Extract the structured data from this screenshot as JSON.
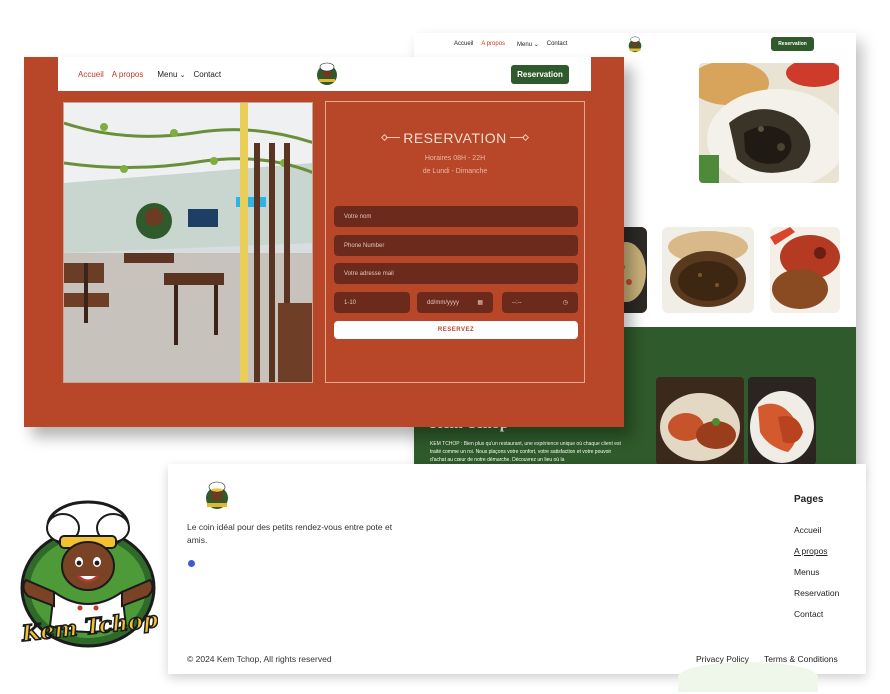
{
  "back": {
    "nav": [
      "Accueil",
      "A propos",
      "Menu",
      "Contact"
    ],
    "reservation": "Reservation",
    "brand": "Kem Tchop",
    "desc": "KEM TCHOP : Bien plus qu'un restaurant, une expérience unique où chaque client est traité comme un roi. Nous plaçons votre confort, votre satisfaction et votre pouvoir d'achat au cœur de notre démarche. Découvrez un lieu où la"
  },
  "nav": {
    "accueil": "Accueil",
    "apropos": "A propos",
    "menu": "Menu",
    "contact": "Contact",
    "reservation": "Reservation",
    "chevron": "chevron-down-icon"
  },
  "form": {
    "title": "RESERVATION",
    "hours": "Horaires 08H - 22H",
    "days": "de Lundi  - Dimanche",
    "name_placeholder": "Votre nom",
    "phone_placeholder": "Phone Number",
    "email_placeholder": "Votre adresse mail",
    "guests": "1-10",
    "date": "dd/mm/yyyy",
    "time": "--:--",
    "submit": "RESERVEZ"
  },
  "footer": {
    "tagline": "Le coin idéal pour des petits rendez-vous entre pote et amis.",
    "pages_title": "Pages",
    "links": [
      "Accueil",
      "A propos",
      "Menus",
      "Reservation",
      "Contact"
    ],
    "copyright": "© 2024 Kem Tchop, All rights reserved",
    "privacy": "Privacy Policy",
    "terms": "Terms & Conditions"
  },
  "logo": {
    "text": "Kem Tchop"
  },
  "colors": {
    "rust": "#b84628",
    "green": "#2f5a2b",
    "field": "#6c2a1d"
  }
}
